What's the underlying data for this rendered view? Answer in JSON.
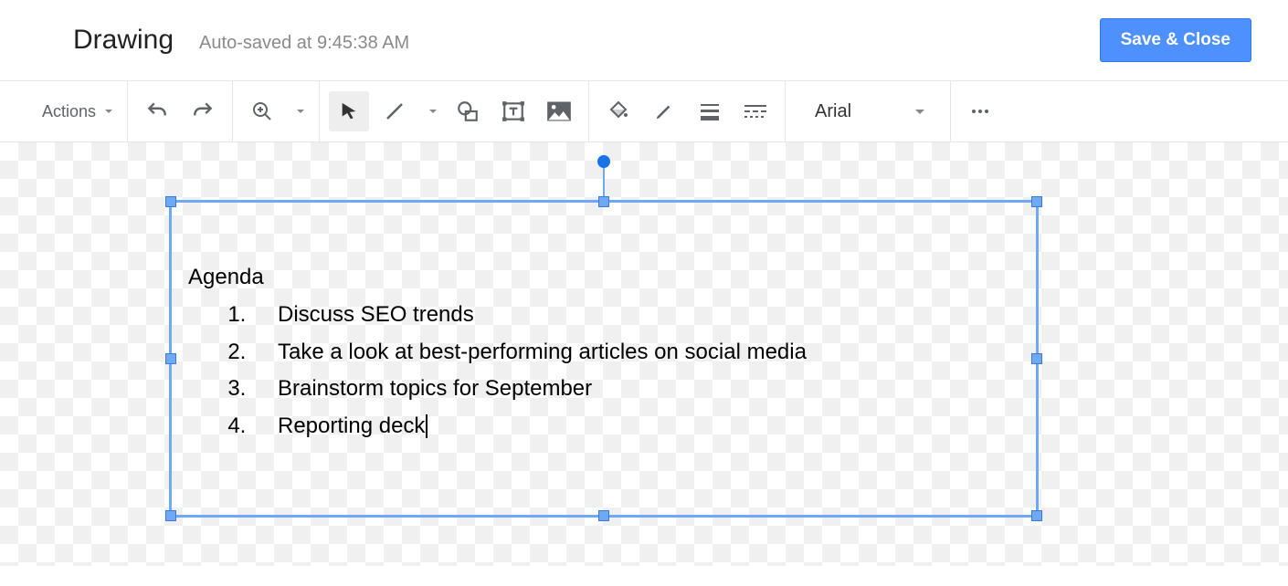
{
  "header": {
    "title": "Drawing",
    "autosave": "Auto-saved at 9:45:38 AM",
    "save_label": "Save & Close"
  },
  "toolbar": {
    "actions_label": "Actions",
    "font_name": "Arial"
  },
  "canvas": {
    "textbox": {
      "heading": "Agenda",
      "items": [
        "Discuss SEO trends",
        "Take a look at best-performing articles on social media",
        "Brainstorm topics for September",
        "Reporting deck"
      ]
    }
  }
}
